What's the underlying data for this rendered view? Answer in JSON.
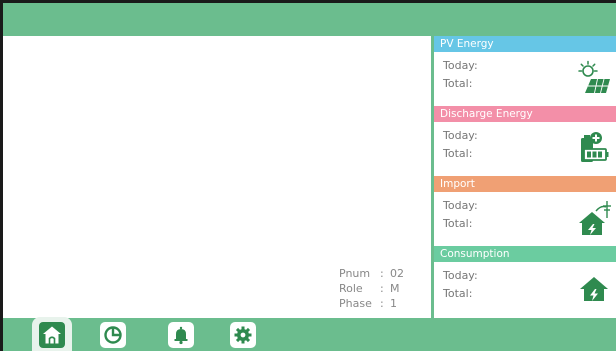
{
  "info": {
    "pnum_label": "Pnum",
    "pnum_value": "02",
    "role_label": "Role",
    "role_value": "M",
    "phase_label": "Phase",
    "phase_value": "1",
    "separator": ":"
  },
  "cards": [
    {
      "title": "PV Energy",
      "today_label": "Today:",
      "total_label": "Total:",
      "color": "#66c6e6",
      "icon": "solar-panel-icon"
    },
    {
      "title": "Discharge Energy",
      "today_label": "Today:",
      "total_label": "Total:",
      "color": "#f38fa8",
      "icon": "battery-plus-icon"
    },
    {
      "title": "Import",
      "today_label": "Today:",
      "total_label": "Total:",
      "color": "#f0a074",
      "icon": "grid-home-icon"
    },
    {
      "title": "Consumption",
      "today_label": "Today:",
      "total_label": "Total:",
      "color": "#6bcca0",
      "icon": "home-icon"
    }
  ],
  "nav": [
    {
      "icon": "home-icon",
      "active": true
    },
    {
      "icon": "pie-chart-icon",
      "active": false
    },
    {
      "icon": "bell-icon",
      "active": false
    },
    {
      "icon": "gear-icon",
      "active": false
    }
  ],
  "colors": {
    "accent": "#6bbd8e",
    "icon_green": "#2f8a4f"
  }
}
